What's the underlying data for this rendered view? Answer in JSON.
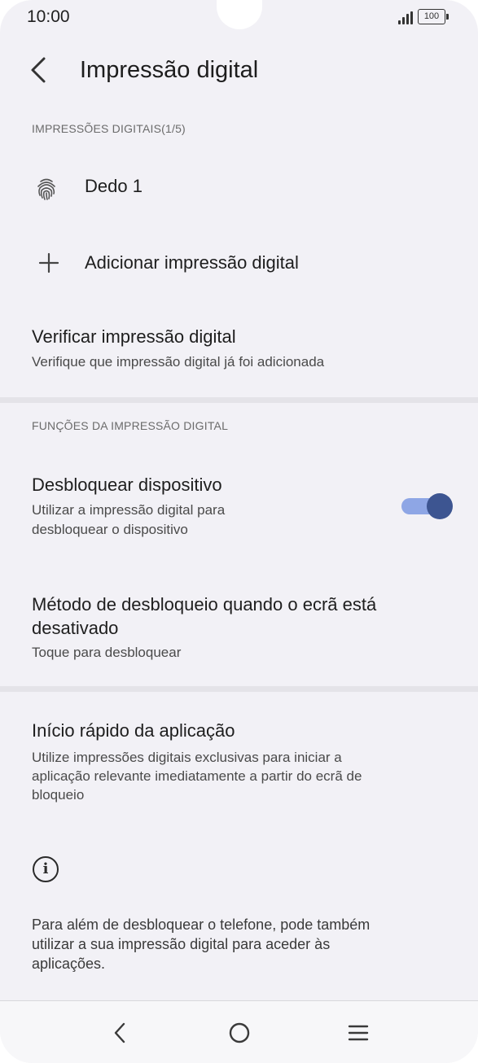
{
  "status_bar": {
    "time": "10:00",
    "battery": "100"
  },
  "app_bar": {
    "title": "Impressão digital",
    "back_icon": "chevron-left-icon"
  },
  "fingerprints_section": {
    "header": "IMPRESSÕES DIGITAIS(1/5)",
    "items": [
      {
        "label": "Dedo 1",
        "icon": "fingerprint-icon"
      }
    ],
    "add_label": "Adicionar impressão digital",
    "add_icon": "plus-icon"
  },
  "verify": {
    "title": "Verificar impressão digital",
    "subtitle": "Verifique que impressão digital já foi adicionada"
  },
  "functions_section": {
    "header": "FUNÇÕES DA IMPRESSÃO DIGITAL",
    "unlock": {
      "title": "Desbloquear dispositivo",
      "subtitle_line1": "Utilizar a impressão digital para",
      "subtitle_line2": "desbloquear o dispositivo",
      "enabled": true
    },
    "screen_off_method": {
      "title_line1": "Método de desbloqueio quando o ecrã está",
      "title_line2": "desativado",
      "subtitle": "Toque para desbloquear"
    }
  },
  "quick_launch": {
    "title": "Início rápido da aplicação",
    "subtitle_line1": "Utilize impressões digitais exclusivas para iniciar a",
    "subtitle_line2": "aplicação relevante imediatamente a partir do ecrã de",
    "subtitle_line3": "bloqueio"
  },
  "info": {
    "icon": "info-icon",
    "line1": "Para além de desbloquear o telefone, pode também",
    "line2": "utilizar a sua impressão digital para aceder às",
    "line3": "aplicações."
  },
  "colors": {
    "accent": "#3d5591",
    "accent_track": "#8ea6e5",
    "background": "#f2f1f6"
  }
}
